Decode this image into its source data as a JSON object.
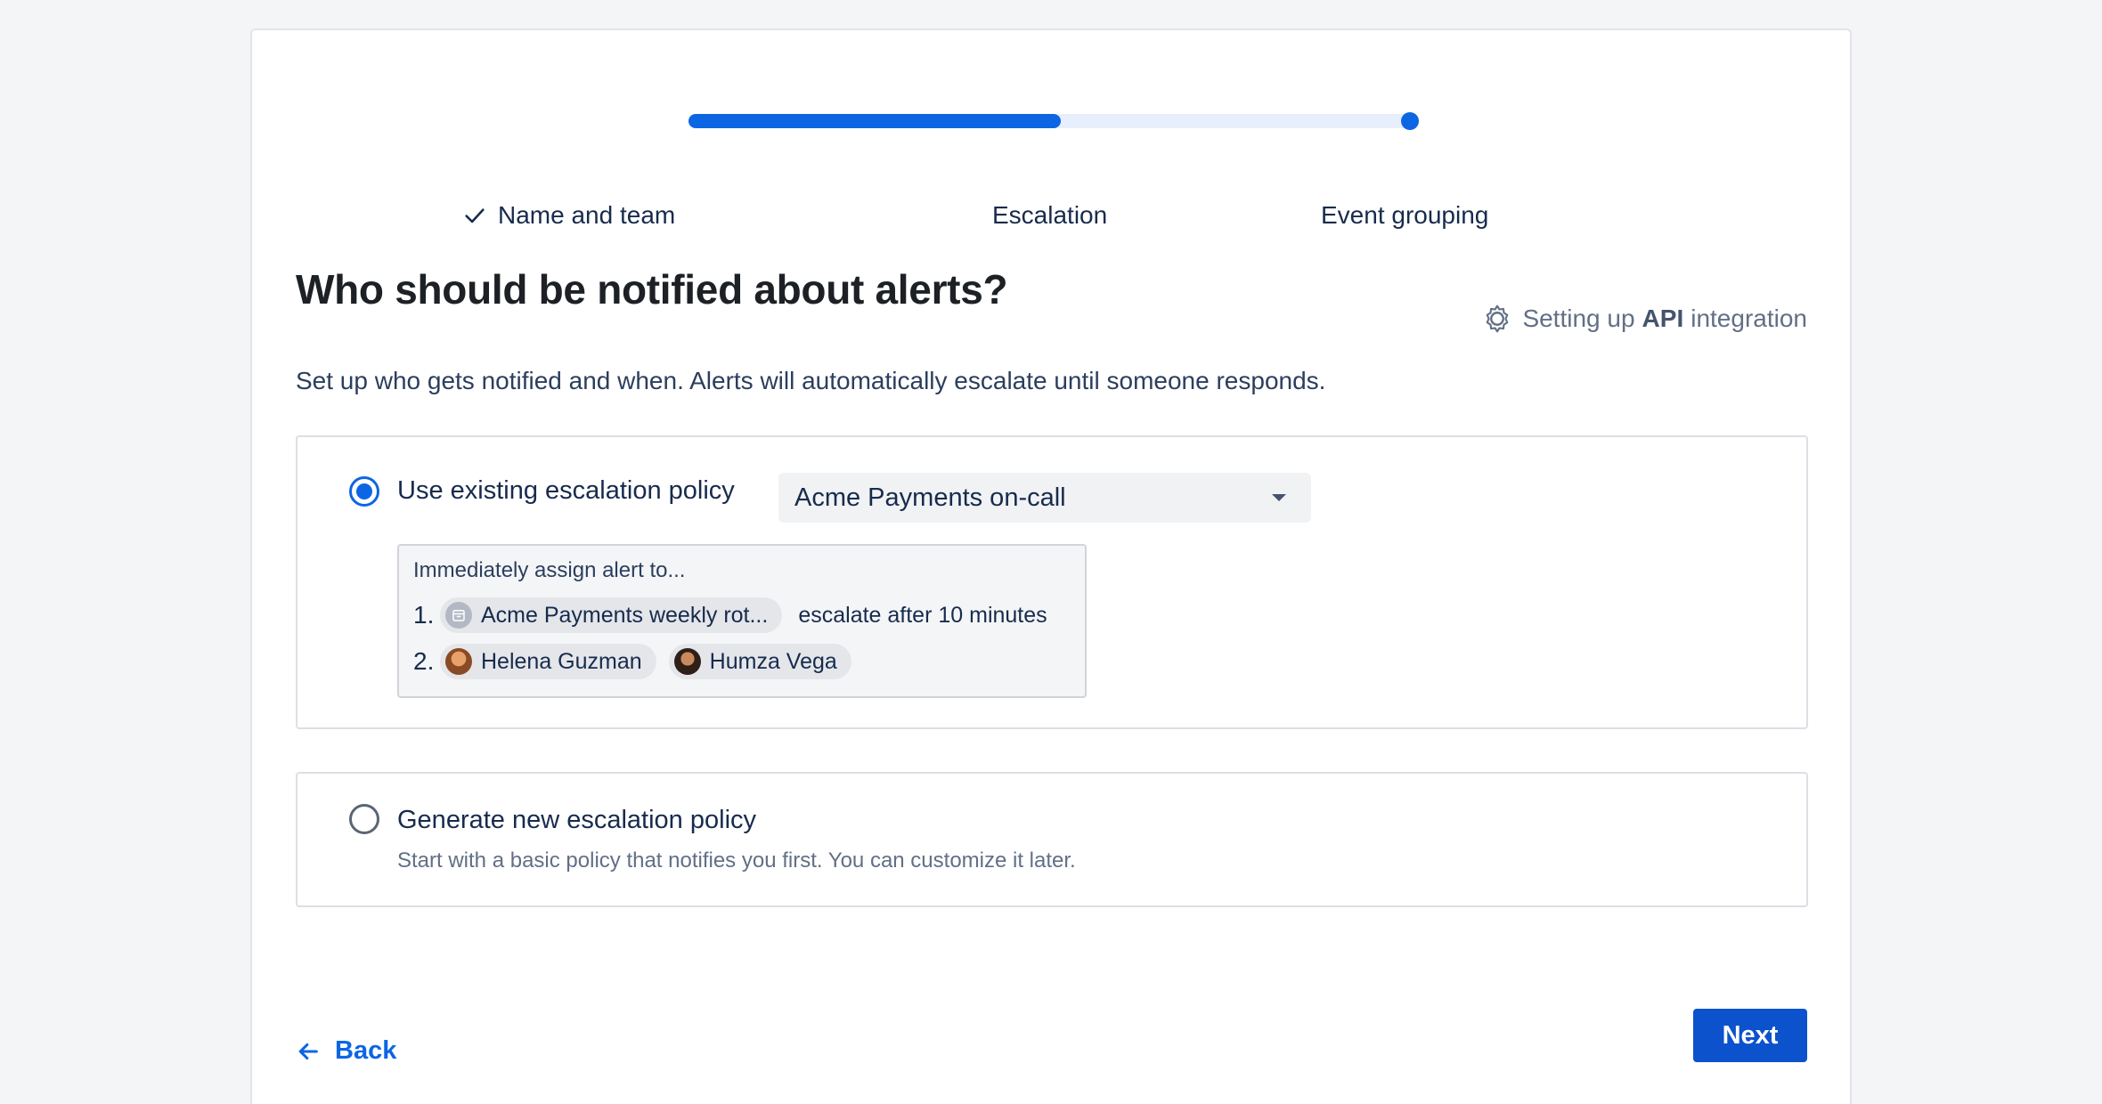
{
  "progress": {
    "value": 0.51
  },
  "steps": [
    {
      "label": "Name and team",
      "done": true
    },
    {
      "label": "Escalation"
    },
    {
      "label": "Event grouping"
    }
  ],
  "heading": "Who should be notified about alerts?",
  "integration_note": {
    "prefix": "Setting up",
    "bold": "API",
    "suffix": "integration",
    "icon": "webhook-icon"
  },
  "subheading": "Set up who gets notified and when. Alerts will automatically escalate until someone responds.",
  "options": {
    "existing": {
      "label": "Use existing escalation policy",
      "selected": true,
      "policy_select": "Acme Payments on-call",
      "policy_preview": {
        "heading": "Immediately assign alert to...",
        "rows": [
          {
            "num": "1.",
            "chips": [
              {
                "name": "Acme Payments weekly rot...",
                "icon": "calendar-icon"
              }
            ],
            "note": "escalate after 10 minutes"
          },
          {
            "num": "2.",
            "chips": [
              {
                "name": "Helena Guzman",
                "icon": "avatar"
              },
              {
                "name": "Humza Vega",
                "icon": "avatar"
              }
            ]
          }
        ]
      }
    },
    "generate": {
      "label": "Generate new escalation policy",
      "selected": false,
      "description": "Start with a basic policy that notifies you first. You can customize it later."
    }
  },
  "footer": {
    "back_label": "Back",
    "next_label": "Next"
  },
  "colors": {
    "accent": "#0c66e4",
    "primary_button": "#0c52cc",
    "track": "#e7eefc"
  }
}
